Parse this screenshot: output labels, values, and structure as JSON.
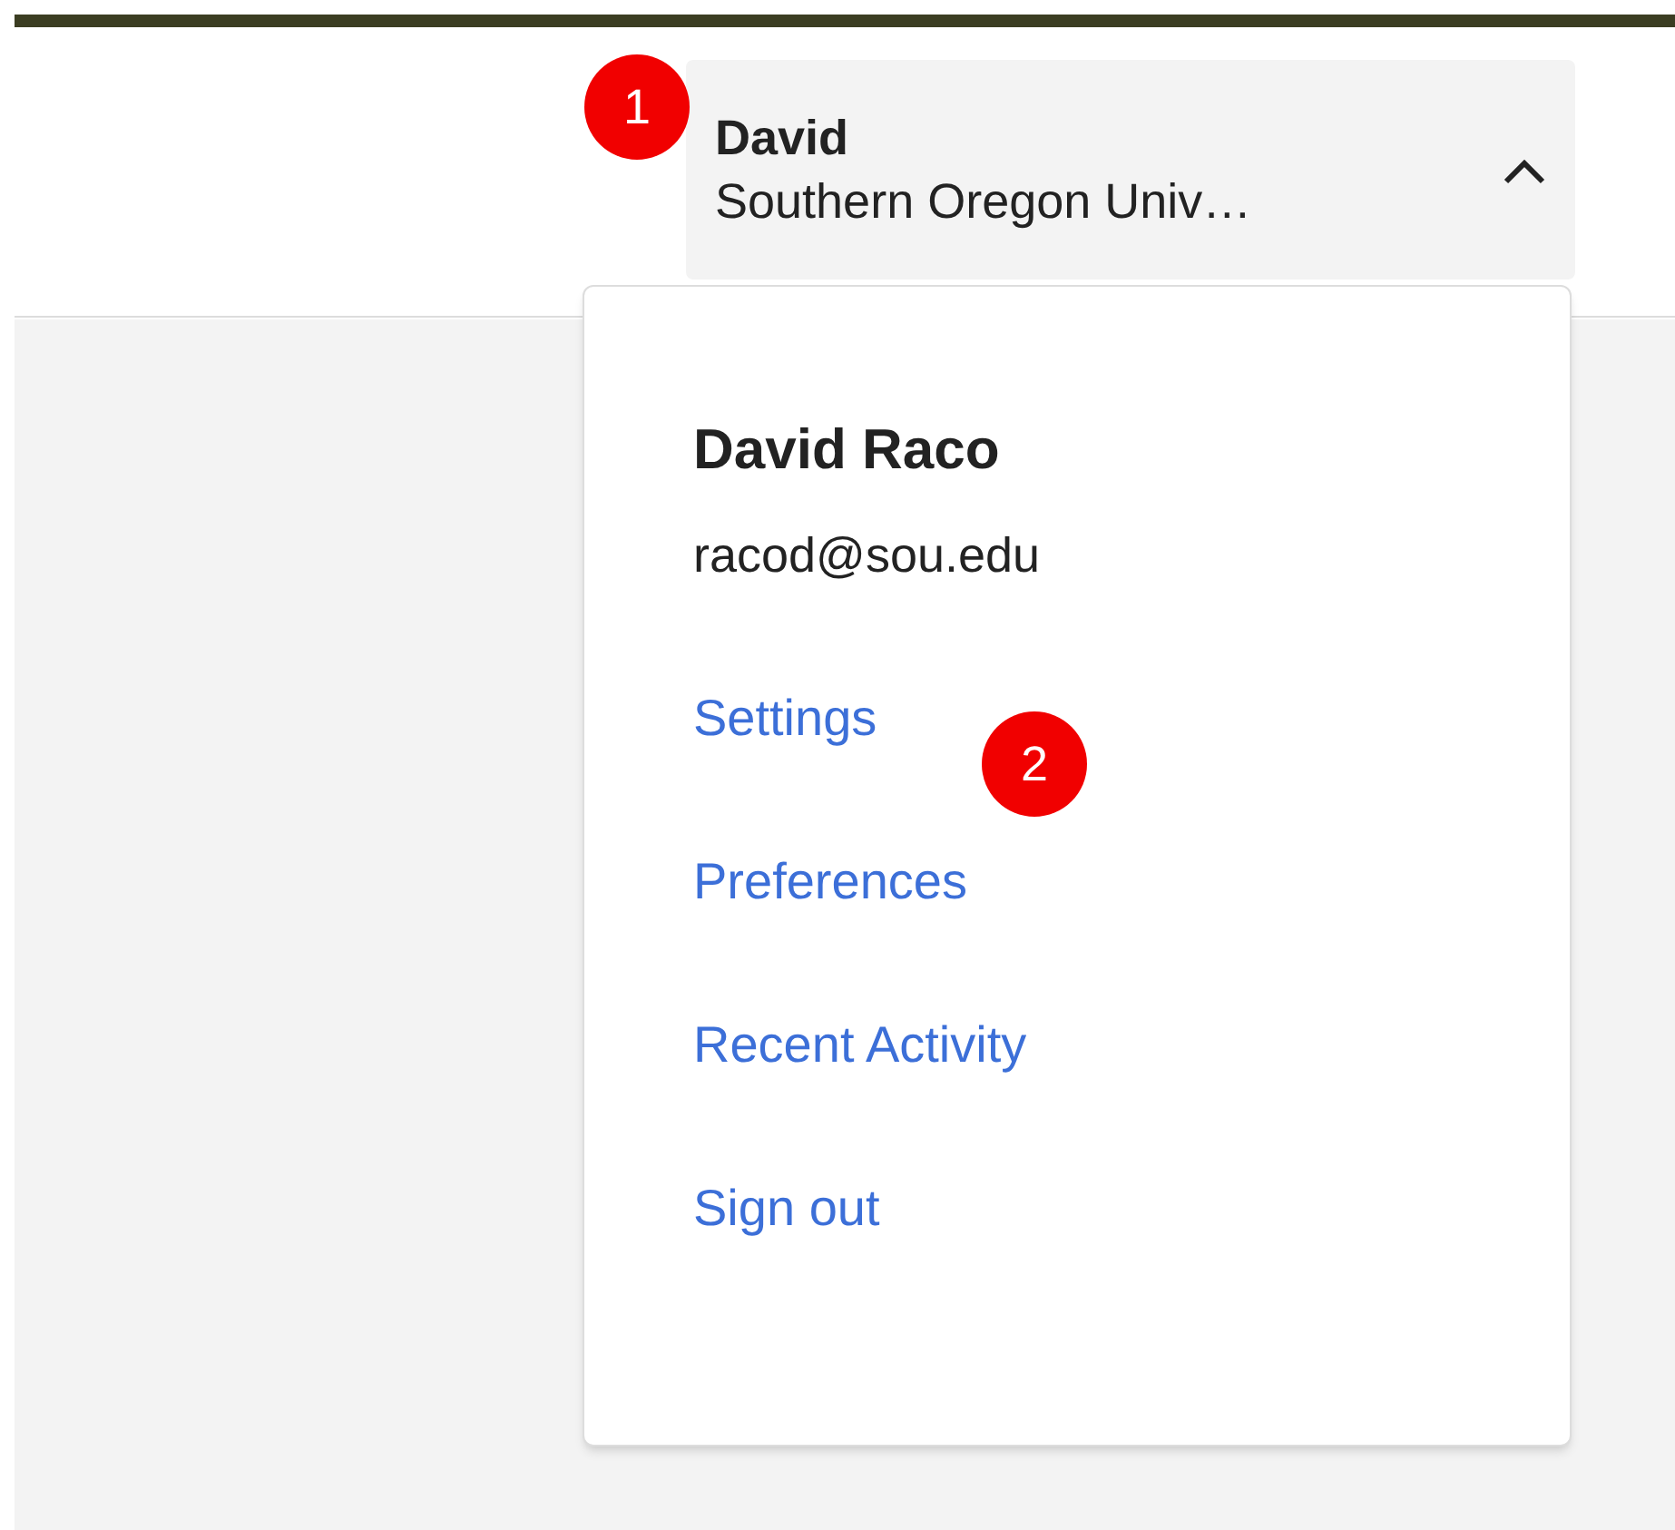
{
  "account": {
    "name": "David",
    "organization": "Southern Oregon Univ…",
    "expanded": true
  },
  "menu": {
    "full_name": "David Raco",
    "email": "racod@sou.edu",
    "items": [
      {
        "label": "Settings"
      },
      {
        "label": "Preferences"
      },
      {
        "label": "Recent Activity"
      },
      {
        "label": "Sign out"
      }
    ]
  },
  "annotations": [
    "1",
    "2"
  ]
}
